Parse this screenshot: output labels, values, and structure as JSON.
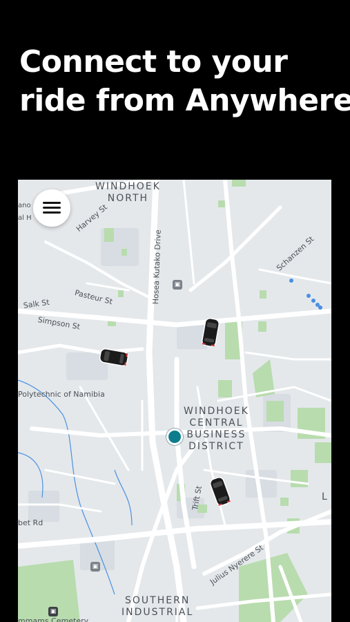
{
  "headline": {
    "line1": "Connect to your",
    "line2": "ride from Anywhere"
  },
  "map": {
    "areas": {
      "windhoek_north_1": "WINDHOEK",
      "windhoek_north_2": "NORTH",
      "cbd_1": "WINDHOEK",
      "cbd_2": "CENTRAL",
      "cbd_3": "BUSINESS",
      "cbd_4": "DISTRICT",
      "southern_1": "SOUTHERN",
      "southern_2": "INDUSTRIAL",
      "edge_l": "L"
    },
    "streets": {
      "harvey": "Harvey St",
      "hosea": "Hosea Kutako Drive",
      "schanzen": "Schanzen St",
      "pasteur": "Pasteur St",
      "salk": "Salk St",
      "simpson": "Simpson St",
      "polytechnic": "Polytechnic of Namibia",
      "trift": "Trift St",
      "bet_rd": "bet Rd",
      "julius": "Julius Nyerere St",
      "cemetery": "mmams Cemetery",
      "edge_and": "ano",
      "edge_al": "al H"
    },
    "icons": {
      "menu": "hamburger-menu-icon",
      "car": "car-icon",
      "location": "current-location-dot",
      "bus": "bus-stop-icon"
    },
    "colors": {
      "map_bg": "#e4e8eb",
      "road": "#ffffff",
      "park": "#b8dcae",
      "water": "#4a90e2",
      "location": "#0c7d8c"
    }
  }
}
